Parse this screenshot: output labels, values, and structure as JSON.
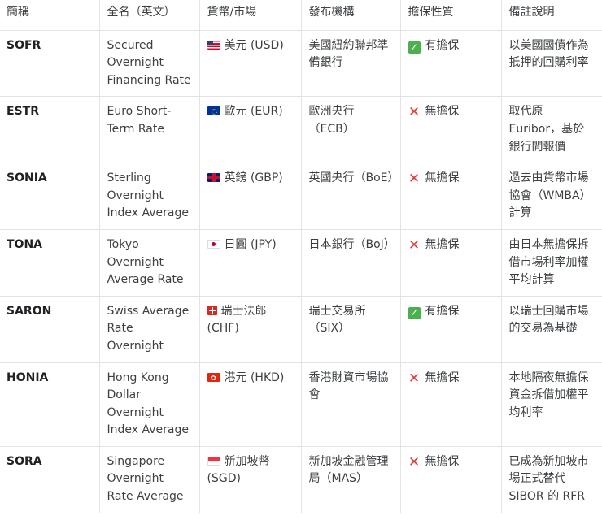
{
  "headers": [
    "簡稱",
    "全名（英文）",
    "貨幣/市場",
    "發布機構",
    "擔保性質",
    "備註說明"
  ],
  "rows": [
    {
      "abbr": "SOFR",
      "name": "Secured Overnight Financing Rate",
      "flag": "us-flag-icon",
      "currency": "美元 (USD)",
      "issuer": "美國紐約聯邦準備銀行",
      "secured": true,
      "secured_label": "有擔保",
      "note": "以美國國債作為抵押的回購利率"
    },
    {
      "abbr": "ESTR",
      "name": "Euro Short-Term Rate",
      "flag": "eu-flag-icon",
      "currency": "歐元 (EUR)",
      "issuer": "歐洲央行（ECB）",
      "secured": false,
      "secured_label": "無擔保",
      "note": "取代原 Euribor，基於銀行間報價"
    },
    {
      "abbr": "SONIA",
      "name": "Sterling Overnight Index Average",
      "flag": "gb-flag-icon",
      "currency": "英鎊 (GBP)",
      "issuer": "英國央行（BoE）",
      "secured": false,
      "secured_label": "無擔保",
      "note": "過去由貨幣市場協會（WMBA）計算"
    },
    {
      "abbr": "TONA",
      "name": "Tokyo Overnight Average Rate",
      "flag": "jp-flag-icon",
      "currency": "日圓 (JPY)",
      "issuer": "日本銀行（BoJ）",
      "secured": false,
      "secured_label": "無擔保",
      "note": "由日本無擔保拆借市場利率加權平均計算"
    },
    {
      "abbr": "SARON",
      "name": "Swiss Average Rate Overnight",
      "flag": "ch-flag-icon",
      "currency": "瑞士法郎 (CHF)",
      "issuer": "瑞士交易所（SIX）",
      "secured": true,
      "secured_label": "有擔保",
      "note": "以瑞士回購市場的交易為基礎"
    },
    {
      "abbr": "HONIA",
      "name": "Hong Kong Dollar Overnight Index Average",
      "flag": "hk-flag-icon",
      "currency": "港元 (HKD)",
      "issuer": "香港財資市場協會",
      "secured": false,
      "secured_label": "無擔保",
      "note": "本地隔夜無擔保資金拆借加權平均利率"
    },
    {
      "abbr": "SORA",
      "name": "Singapore Overnight Rate Average",
      "flag": "sg-flag-icon",
      "currency": "新加坡幣 (SGD)",
      "issuer": "新加坡金融管理局（MAS）",
      "secured": false,
      "secured_label": "無擔保",
      "note": "已成為新加坡市場正式替代 SIBOR 的 RFR"
    }
  ]
}
